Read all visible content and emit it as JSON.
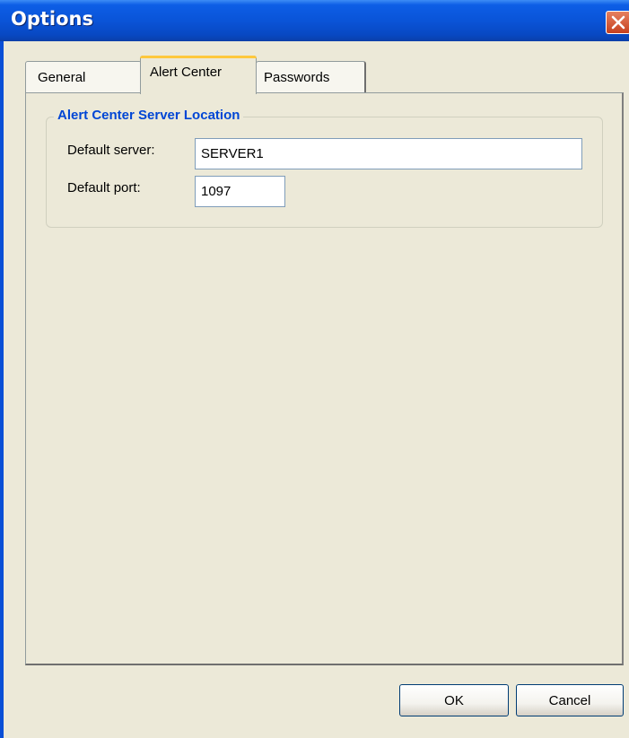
{
  "window": {
    "title": "Options"
  },
  "tabs": [
    {
      "label": "General"
    },
    {
      "label": "Alert Center",
      "selected": true
    },
    {
      "label": "Passwords"
    }
  ],
  "group": {
    "title": "Alert Center Server Location",
    "server_label": "Default server:",
    "server_value": "SERVER1",
    "port_label": "Default port:",
    "port_value": "1097"
  },
  "buttons": {
    "ok": "OK",
    "cancel": "Cancel"
  },
  "colors": {
    "titlebar": "#0a54d8",
    "close_button": "#d8542e",
    "group_title": "#0046d5",
    "background": "#ece9d8",
    "active_tab_highlight": "#ffc83c"
  }
}
